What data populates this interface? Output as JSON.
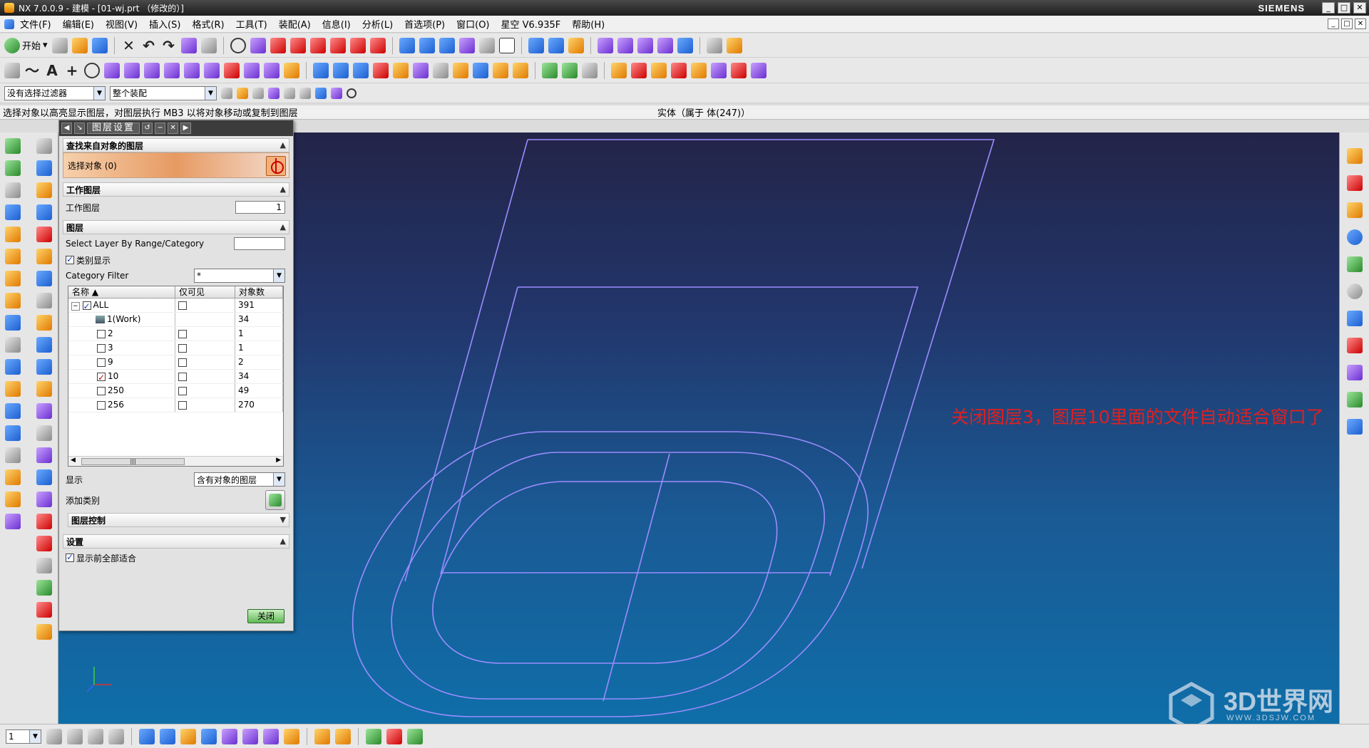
{
  "app": {
    "title": "NX 7.0.0.9 - 建模 - [01-wj.prt （修改的）]",
    "brand": "SIEMENS",
    "window_buttons": [
      "_",
      "□",
      "✕"
    ]
  },
  "menu": {
    "items": [
      "文件(F)",
      "编辑(E)",
      "视图(V)",
      "插入(S)",
      "格式(R)",
      "工具(T)",
      "装配(A)",
      "信息(I)",
      "分析(L)",
      "首选项(P)",
      "窗口(O)",
      "星空 V6.935F",
      "帮助(H)"
    ]
  },
  "toolbar": {
    "start_label": "开始",
    "selection_filter": "没有选择过滤器",
    "assembly_scope": "整个装配",
    "layer_number": "1"
  },
  "status": {
    "prompt": "选择对象以高亮显示图层，对图层执行 MB3 以将对象移动或复制到图层",
    "info": "实体（属于 体(247)）"
  },
  "dialog": {
    "title": "图层设置",
    "section_find": "查找来自对象的图层",
    "select_objects": "选择对象 (0)",
    "section_work_layer": "工作图层",
    "work_layer_label": "工作图层",
    "work_layer_value": "1",
    "section_layers": "图层",
    "select_by_range_label": "Select Layer By Range/Category",
    "category_display_label": "类别显示",
    "category_filter_label": "Category Filter",
    "category_filter_value": "*",
    "table": {
      "headers": [
        "名称",
        "仅可见",
        "对象数"
      ],
      "rows": [
        {
          "name": "ALL",
          "visible_only": "",
          "count": "391"
        },
        {
          "name": "1(Work)",
          "visible_only": "",
          "count": "34"
        },
        {
          "name": "2",
          "visible_only": "",
          "count": "1"
        },
        {
          "name": "3",
          "visible_only": "",
          "count": "1"
        },
        {
          "name": "9",
          "visible_only": "",
          "count": "2"
        },
        {
          "name": "10",
          "visible_only": "",
          "count": "34"
        },
        {
          "name": "250",
          "visible_only": "",
          "count": "49"
        },
        {
          "name": "256",
          "visible_only": "",
          "count": "270"
        }
      ]
    },
    "display_label": "显示",
    "display_value": "含有对象的图层",
    "add_category_label": "添加类别",
    "section_layer_control": "图层控制",
    "section_settings": "设置",
    "fit_before_display_label": "显示前全部适合",
    "close_label": "关闭"
  },
  "annotation": "关闭图层3，图层10里面的文件自动适合窗口了",
  "watermark": {
    "main": "3D世界网",
    "sub": "WWW.3DSJW.COM"
  },
  "colors": {
    "viewport_top": "#232448",
    "viewport_bottom": "#0f6ea8",
    "wireframe": "#9b8cff",
    "annotation": "#e02020"
  }
}
